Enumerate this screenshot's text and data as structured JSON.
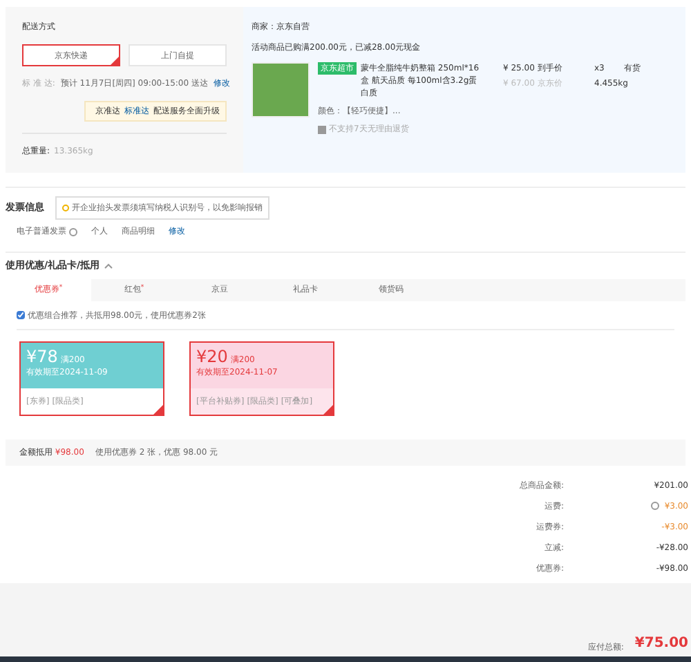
{
  "delivery": {
    "title": "配送方式",
    "options": [
      {
        "label": "京东快递",
        "selected": true
      },
      {
        "label": "上门自提",
        "selected": false
      }
    ],
    "schedule_label": "标 准 达:",
    "schedule": "预计 11月7日[周四] 09:00-15:00 送达",
    "edit": "修改",
    "upgrade": [
      "京准达",
      "标准达",
      "配送服务全面升级"
    ],
    "weight_label": "总重量:",
    "weight": "13.365kg"
  },
  "shop": {
    "seller": "商家：京东自营",
    "promo": "活动商品已购满200.00元，已减28.00元现金",
    "item": {
      "tag": "京东超市",
      "name": "蒙牛全脂纯牛奶整箱 250ml*16盒 航天品质 每100ml含3.2g蛋白质",
      "variant": "颜色：【轻巧便捷】...",
      "notice": "不支持7天无理由退货",
      "price": "¥ 25.00 到手价",
      "list_price": "¥ 67.00 京东价",
      "qty": "x3",
      "stock": "有货",
      "weight": "4.455kg"
    }
  },
  "invoice": {
    "title": "发票信息",
    "tip": "开企业抬头发票须填写纳税人识别号，以免影响报销",
    "type": "电子普通发票",
    "holder": "个人",
    "content": "商品明细",
    "edit": "修改"
  },
  "discount": {
    "title": "使用优惠/礼品卡/抵用",
    "expanded": true,
    "tabs": [
      {
        "label": "优惠券",
        "selected": true,
        "mark": "*"
      },
      {
        "label": "红包",
        "selected": false,
        "mark": "*"
      },
      {
        "label": "京豆",
        "selected": false
      },
      {
        "label": "礼品卡",
        "selected": false
      },
      {
        "label": "领货码",
        "selected": false
      }
    ],
    "recommend": {
      "checked": true,
      "label": "优惠组合推荐，共抵用98.00元，使用优惠券2张"
    },
    "coupons": [
      {
        "kind": "teal",
        "amount": "¥78",
        "threshold": "满200",
        "expiry": "有效期至2024-11-09",
        "tags": [
          "[东券]",
          "[限品类]"
        ],
        "selected": true
      },
      {
        "kind": "pink",
        "amount": "¥20",
        "threshold": "满200",
        "expiry": "有效期至2024-11-07",
        "tags": [
          "[平台补贴券]",
          "[限品类]",
          "[可叠加]"
        ],
        "selected": true
      }
    ],
    "total_label": "金额抵用",
    "total": "¥98.00",
    "total_note": "使用优惠券 2 张，优惠 98.00 元"
  },
  "summary": {
    "rows": [
      {
        "label": "总商品金额:",
        "value": "¥201.00",
        "kind": "plain"
      },
      {
        "label": "运费:",
        "value": "¥3.00",
        "kind": "info"
      },
      {
        "label": "运费券:",
        "value": "-¥3.00",
        "kind": "discount"
      },
      {
        "label": "立减:",
        "value": "-¥28.00",
        "kind": "plain"
      },
      {
        "label": "优惠券:",
        "value": "-¥98.00",
        "kind": "plain"
      }
    ],
    "payable_label": "应付总额:",
    "payable": "¥75.00"
  }
}
